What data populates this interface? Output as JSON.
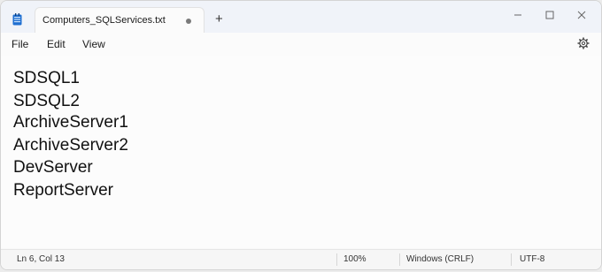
{
  "tab": {
    "title": "Computers_SQLServices.txt",
    "new_tab_label": "+"
  },
  "menu": {
    "file": "File",
    "edit": "Edit",
    "view": "View"
  },
  "editor": {
    "lines": [
      "SDSQL1",
      "SDSQL2",
      "ArchiveServer1",
      "ArchiveServer2",
      "DevServer",
      "ReportServer"
    ]
  },
  "status": {
    "position": "Ln 6, Col 13",
    "zoom": "100%",
    "line_ending": "Windows (CRLF)",
    "encoding": "UTF-8"
  },
  "icons": {
    "app": "notepad-icon",
    "unsaved": "unsaved-dot-icon",
    "minimize": "minimize-icon",
    "maximize": "maximize-icon",
    "close": "close-icon",
    "settings": "gear-icon"
  },
  "colors": {
    "app_icon": "#1f6fd1",
    "titlebar": "#f0f3f9"
  }
}
